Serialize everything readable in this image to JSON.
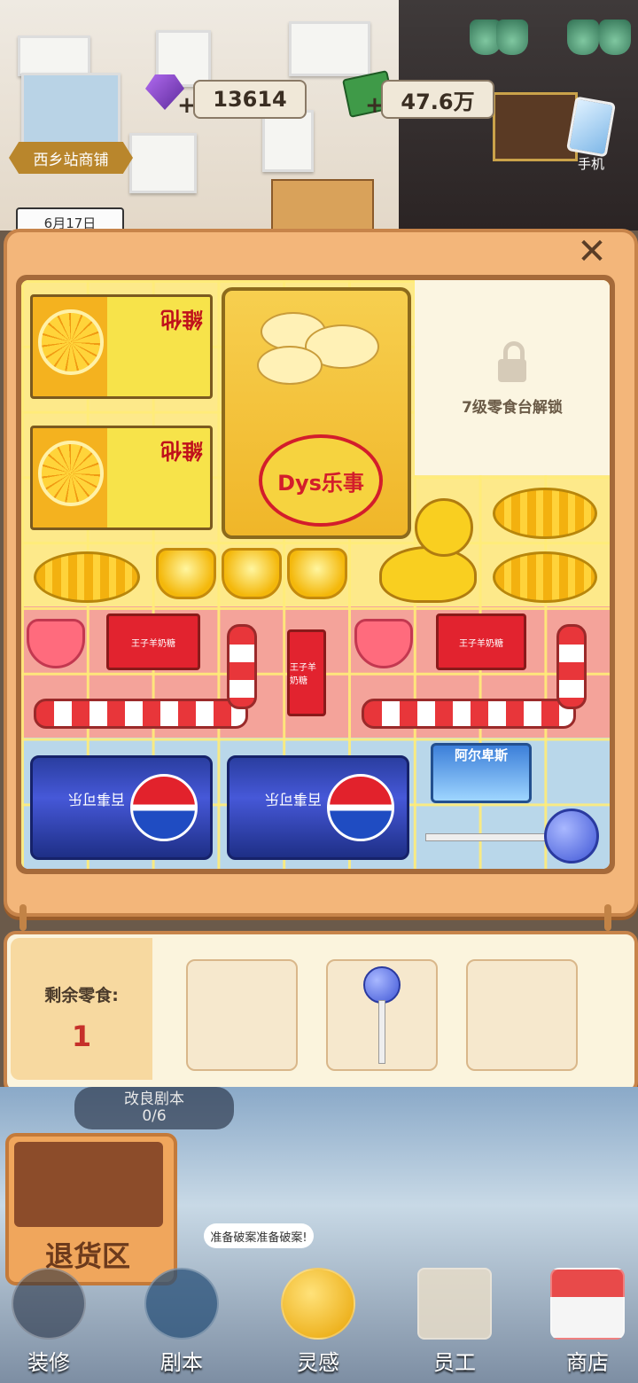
{
  "top_bar": {
    "gems": "13614",
    "cash": "47.6万",
    "shop_name": "西乡站商铺",
    "date": "6月17日",
    "phone_label": "手机"
  },
  "panel": {
    "locked_text": "7级零食台解锁",
    "items": {
      "juice_label": "維他",
      "chips_logo": "Dys乐事",
      "cola_text": "百事可乐",
      "candy_text": "王子羊奶糖",
      "choco_text": "阿尔卑斯"
    }
  },
  "tray": {
    "remaining_label": "剩余零食:",
    "remaining_count": "1"
  },
  "bottom": {
    "quest_title": "改良剧本",
    "quest_progress": "0/6",
    "return_label": "退货区",
    "speech": "准备破案准备破案!",
    "nav": [
      {
        "label": "装修",
        "icon": "house-icon"
      },
      {
        "label": "剧本",
        "icon": "book-icon"
      },
      {
        "label": "灵感",
        "icon": "bulb-icon"
      },
      {
        "label": "员工",
        "icon": "badge-icon"
      },
      {
        "label": "商店",
        "icon": "shop-icon"
      }
    ]
  }
}
